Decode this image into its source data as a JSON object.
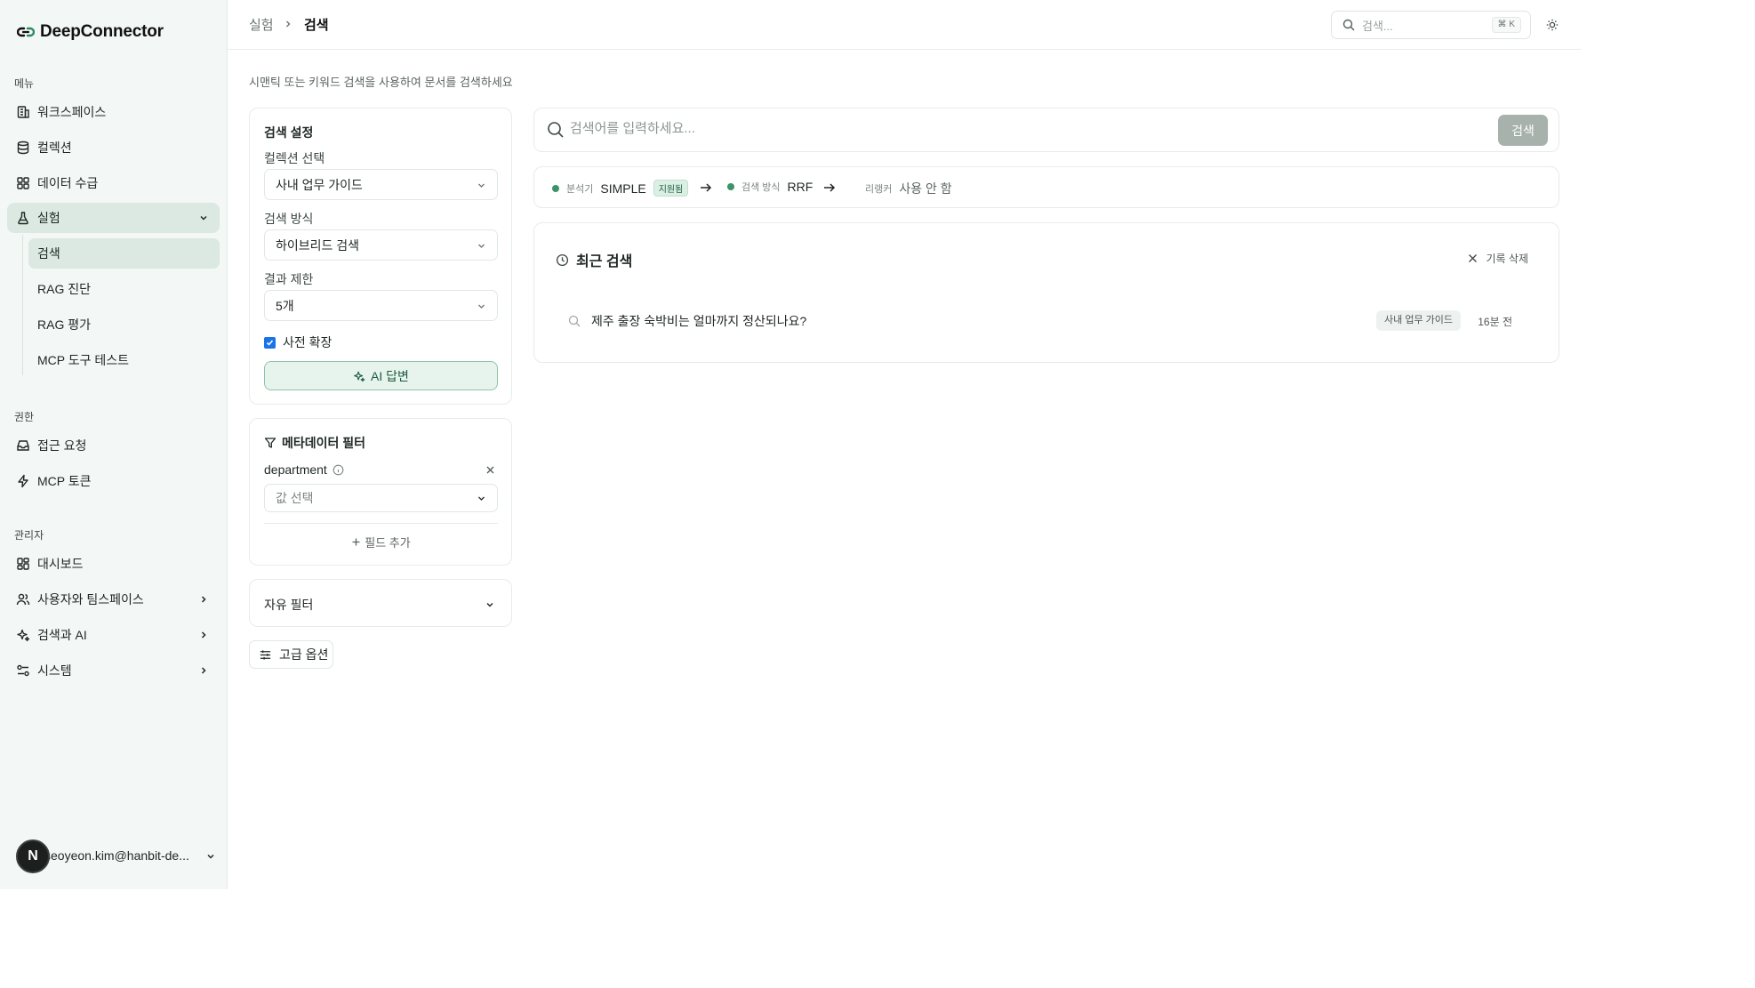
{
  "app": {
    "name": "DeepConnector"
  },
  "sidebar": {
    "sections": {
      "menu": "메뉴",
      "permissions": "권한",
      "admin": "관리자"
    },
    "menu_items": [
      {
        "label": "워크스페이스",
        "icon": "building-icon"
      },
      {
        "label": "컬렉션",
        "icon": "database-icon"
      },
      {
        "label": "데이터 수급",
        "icon": "grid-icon"
      },
      {
        "label": "실험",
        "icon": "flask-icon"
      }
    ],
    "experiment_sub": [
      {
        "label": "검색"
      },
      {
        "label": "RAG 진단"
      },
      {
        "label": "RAG 평가"
      },
      {
        "label": "MCP 도구 테스트"
      }
    ],
    "permission_items": [
      {
        "label": "접근 요청",
        "icon": "inbox-icon"
      },
      {
        "label": "MCP 토큰",
        "icon": "bolt-icon"
      }
    ],
    "admin_items": [
      {
        "label": "대시보드",
        "icon": "dashboard-icon"
      },
      {
        "label": "사용자와 팀스페이스",
        "icon": "users-icon"
      },
      {
        "label": "검색과 AI",
        "icon": "sparkles-icon"
      },
      {
        "label": "시스템",
        "icon": "settings-icon"
      }
    ],
    "user": {
      "avatar_letter": "N",
      "email": "seoyeon.kim@hanbit-de..."
    }
  },
  "header": {
    "breadcrumb_parent": "실험",
    "breadcrumb_current": "검색",
    "search_placeholder": "검색...",
    "shortcut": "⌘ K"
  },
  "main": {
    "subtitle": "시맨틱 또는 키워드 검색을 사용하여 문서를 검색하세요",
    "settings": {
      "title": "검색 설정",
      "collection_label": "컬렉션 선택",
      "collection_value": "사내 업무 가이드",
      "method_label": "검색 방식",
      "method_value": "하이브리드 검색",
      "limit_label": "결과 제한",
      "limit_value": "5개",
      "dict_expand_label": "사전 확장",
      "dict_expand_checked": true,
      "ai_answer_label": "AI 답변"
    },
    "metadata_filter": {
      "title": "메타데이터 필터",
      "field_name": "department",
      "value_placeholder": "값 선택",
      "add_field_label": "필드 추가"
    },
    "free_filter": {
      "label": "자유 필터"
    },
    "advanced_options_label": "고급 옵션",
    "search": {
      "placeholder": "검색어를 입력하세요...",
      "button_label": "검색"
    },
    "pipeline": {
      "analyzer_key": "분석기",
      "analyzer_value": "SIMPLE",
      "analyzer_badge": "지원됨",
      "method_key": "검색 방식",
      "method_value": "RRF",
      "reranker_key": "리랭커",
      "reranker_value": "사용 안 함"
    },
    "recent": {
      "title": "최근 검색",
      "clear_label": "기록 삭제",
      "items": [
        {
          "query": "제주 출장 숙박비는 얼마까지 정산되나요?",
          "collection": "사내 업무 가이드",
          "time": "16분 전"
        }
      ]
    }
  },
  "colors": {
    "accent": "#3b9468",
    "sidebar_bg": "#f3f7f5",
    "active_bg": "#dbe9e2",
    "checkbox": "#1a73e8"
  }
}
